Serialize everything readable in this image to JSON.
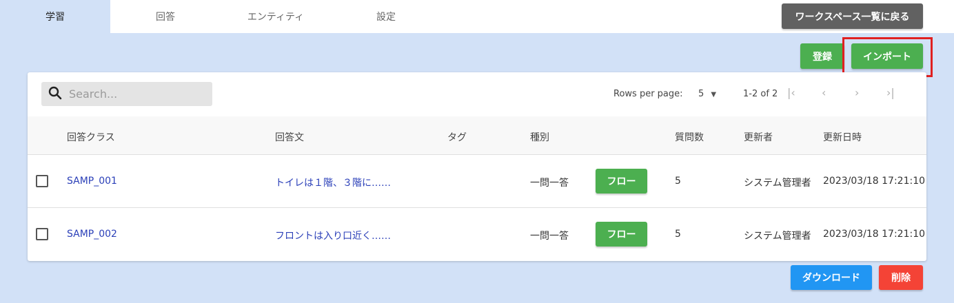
{
  "tabs": [
    {
      "label": "学習",
      "active": true
    },
    {
      "label": "回答",
      "active": false
    },
    {
      "label": "エンティティ",
      "active": false
    },
    {
      "label": "設定",
      "active": false
    }
  ],
  "header": {
    "back_label": "ワークスペース一覧に戻る"
  },
  "actions": {
    "register_label": "登録",
    "import_label": "インポート"
  },
  "search": {
    "placeholder": "Search..."
  },
  "pagination": {
    "rows_per_page_label": "Rows per page:",
    "rows_per_page_value": "5",
    "range": "1-2 of 2"
  },
  "table": {
    "columns": [
      "回答クラス",
      "回答文",
      "タグ",
      "種別",
      "質問数",
      "更新者",
      "更新日時"
    ],
    "rows": [
      {
        "answer_class": "SAMP_001",
        "answer_text": "トイレは１階、３階に……",
        "tag": "",
        "type": "一問一答",
        "flow_label": "フロー",
        "question_count": "5",
        "updater": "システム管理者",
        "updated_at": "2023/03/18 17:21:10"
      },
      {
        "answer_class": "SAMP_002",
        "answer_text": "フロントは入り口近く……",
        "tag": "",
        "type": "一問一答",
        "flow_label": "フロー",
        "question_count": "5",
        "updater": "システム管理者",
        "updated_at": "2023/03/18 17:21:10"
      }
    ]
  },
  "footer": {
    "download_label": "ダウンロード",
    "delete_label": "削除"
  },
  "colors": {
    "background": "#d2e1f7",
    "green": "#4caf50",
    "blue": "#2196f3",
    "red": "#f44336",
    "dark": "#616161",
    "highlight": "#e02020"
  }
}
